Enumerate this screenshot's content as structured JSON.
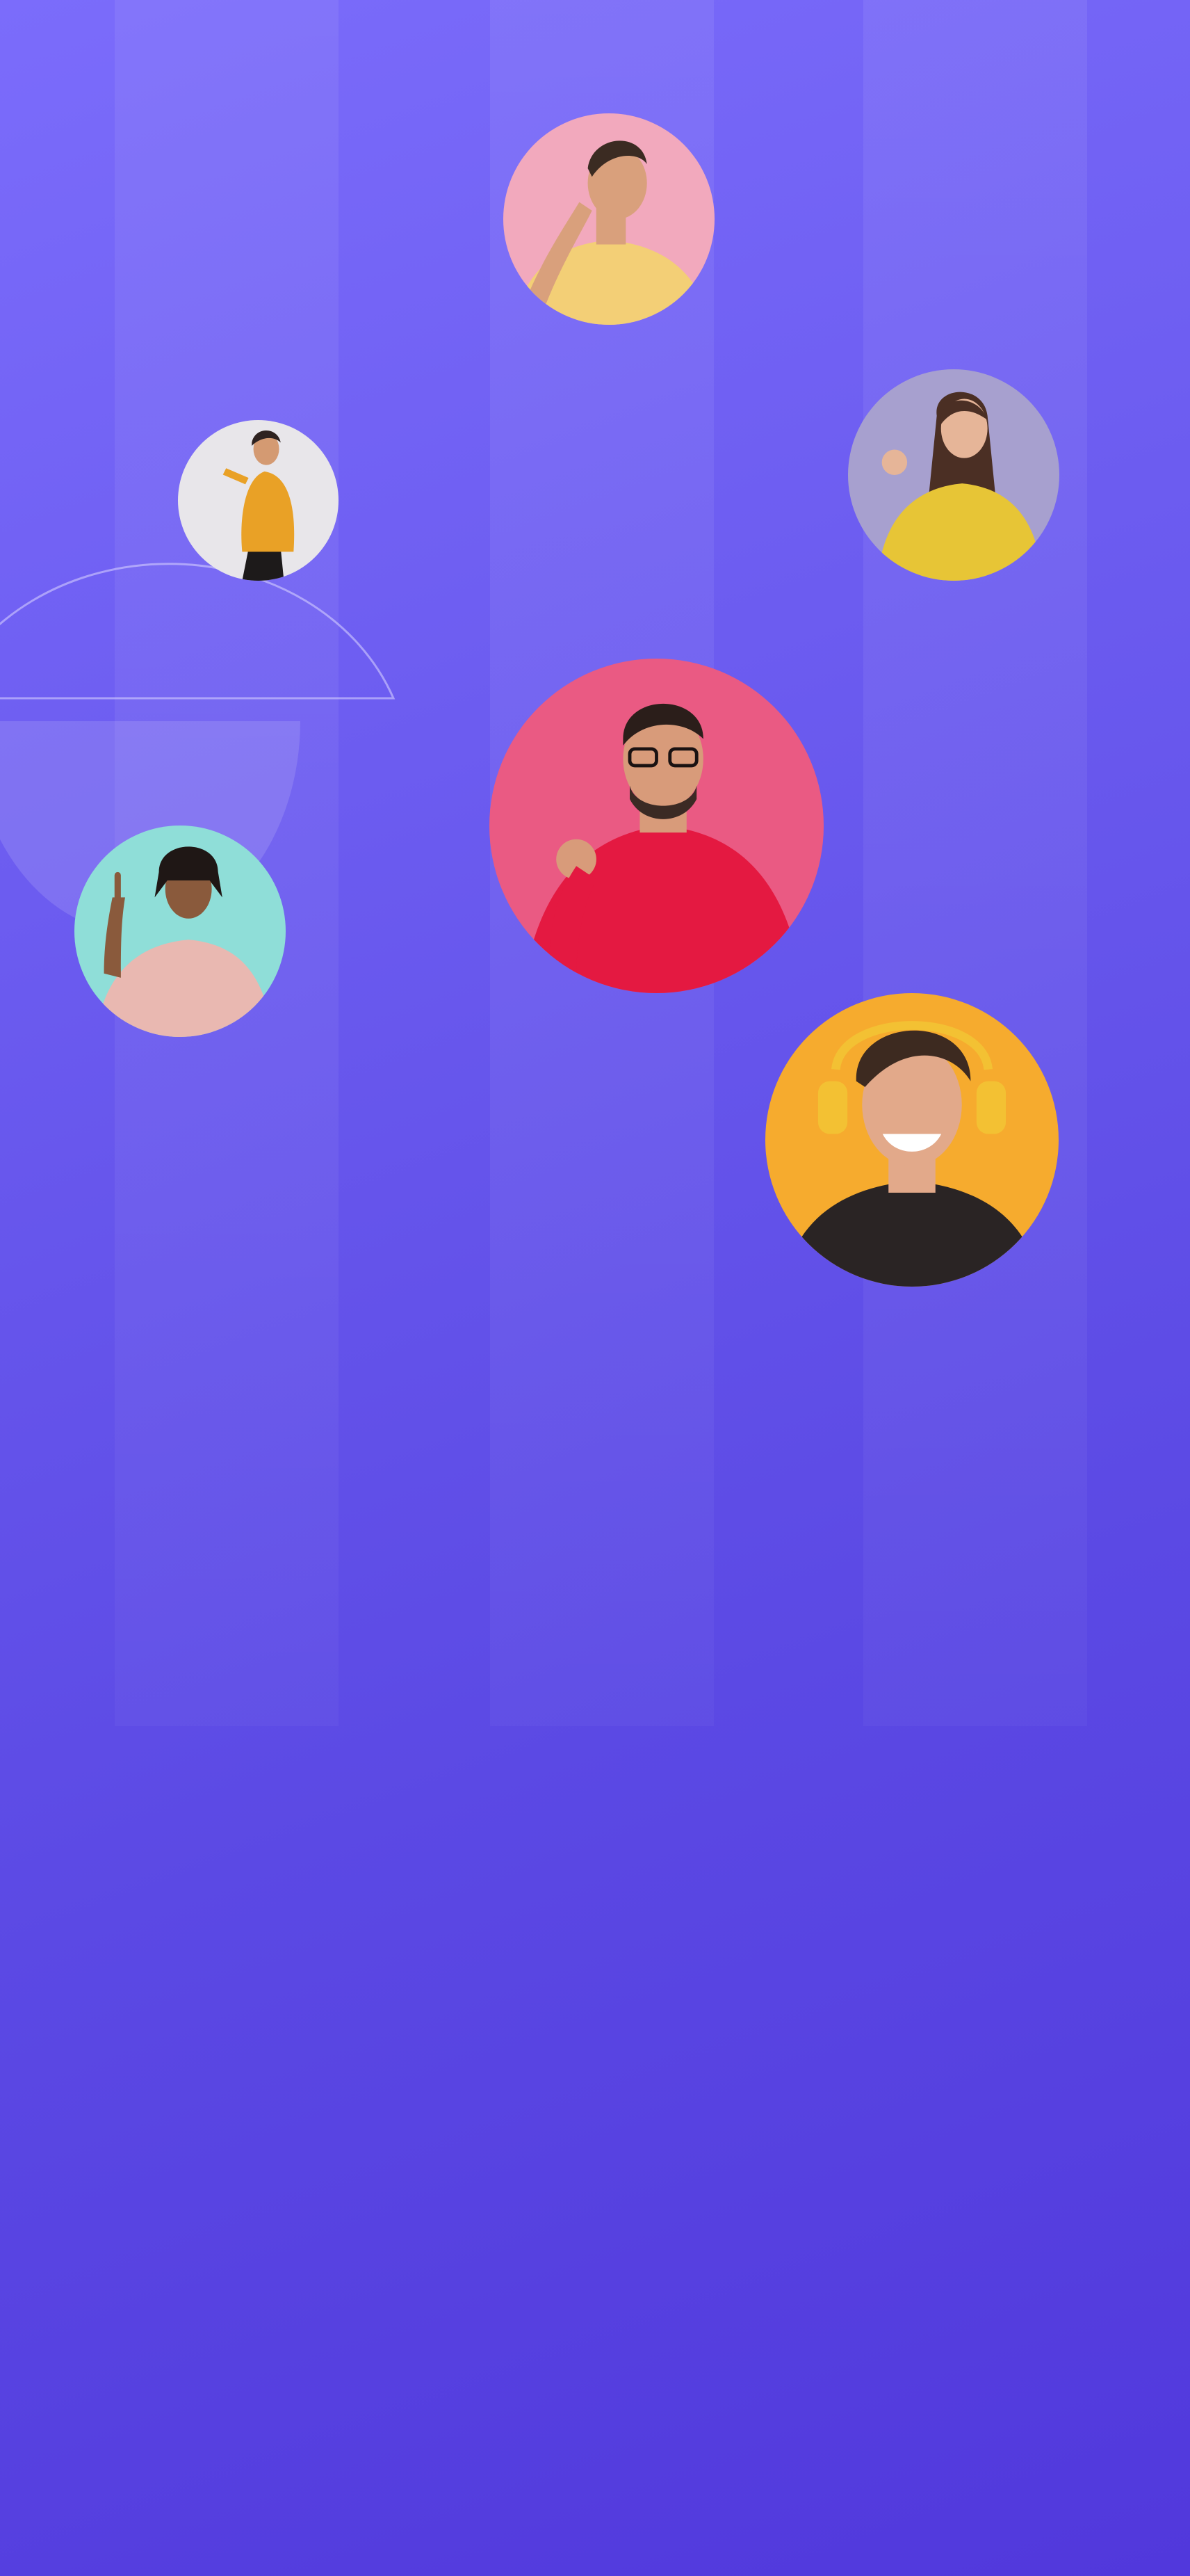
{
  "colors": {
    "background_top": "#7b6cfb",
    "background_bottom": "#5138dc",
    "decor_line": "#b9b0ff"
  },
  "avatars": [
    {
      "id": "avatar-yellow-tee-man",
      "bg": "#f2a9bd",
      "shirt": "#f3cf76",
      "skin": "#d9a07c",
      "hair": "#3b2b22"
    },
    {
      "id": "avatar-orange-sweater-man",
      "bg": "#e8e6ea",
      "shirt": "#e9a126",
      "skin": "#d49a72",
      "hair": "#2e2220"
    },
    {
      "id": "avatar-yellow-sweater-woman",
      "bg": "#a7a0cf",
      "shirt": "#e7c536",
      "skin": "#e6b598",
      "hair": "#4b2f24"
    },
    {
      "id": "avatar-red-sweater-man",
      "bg": "#ea5a83",
      "shirt": "#e41941",
      "skin": "#d89b7a",
      "hair": "#2b1e1a"
    },
    {
      "id": "avatar-pink-hoodie-man",
      "bg": "#8fded8",
      "shirt": "#e9b8b1",
      "skin": "#8a5a3c",
      "hair": "#1f1715"
    },
    {
      "id": "avatar-headphones-man",
      "bg": "#f6ab2e",
      "shirt": "#2a2424",
      "skin": "#e2a98a",
      "hair": "#3d2a20"
    }
  ]
}
